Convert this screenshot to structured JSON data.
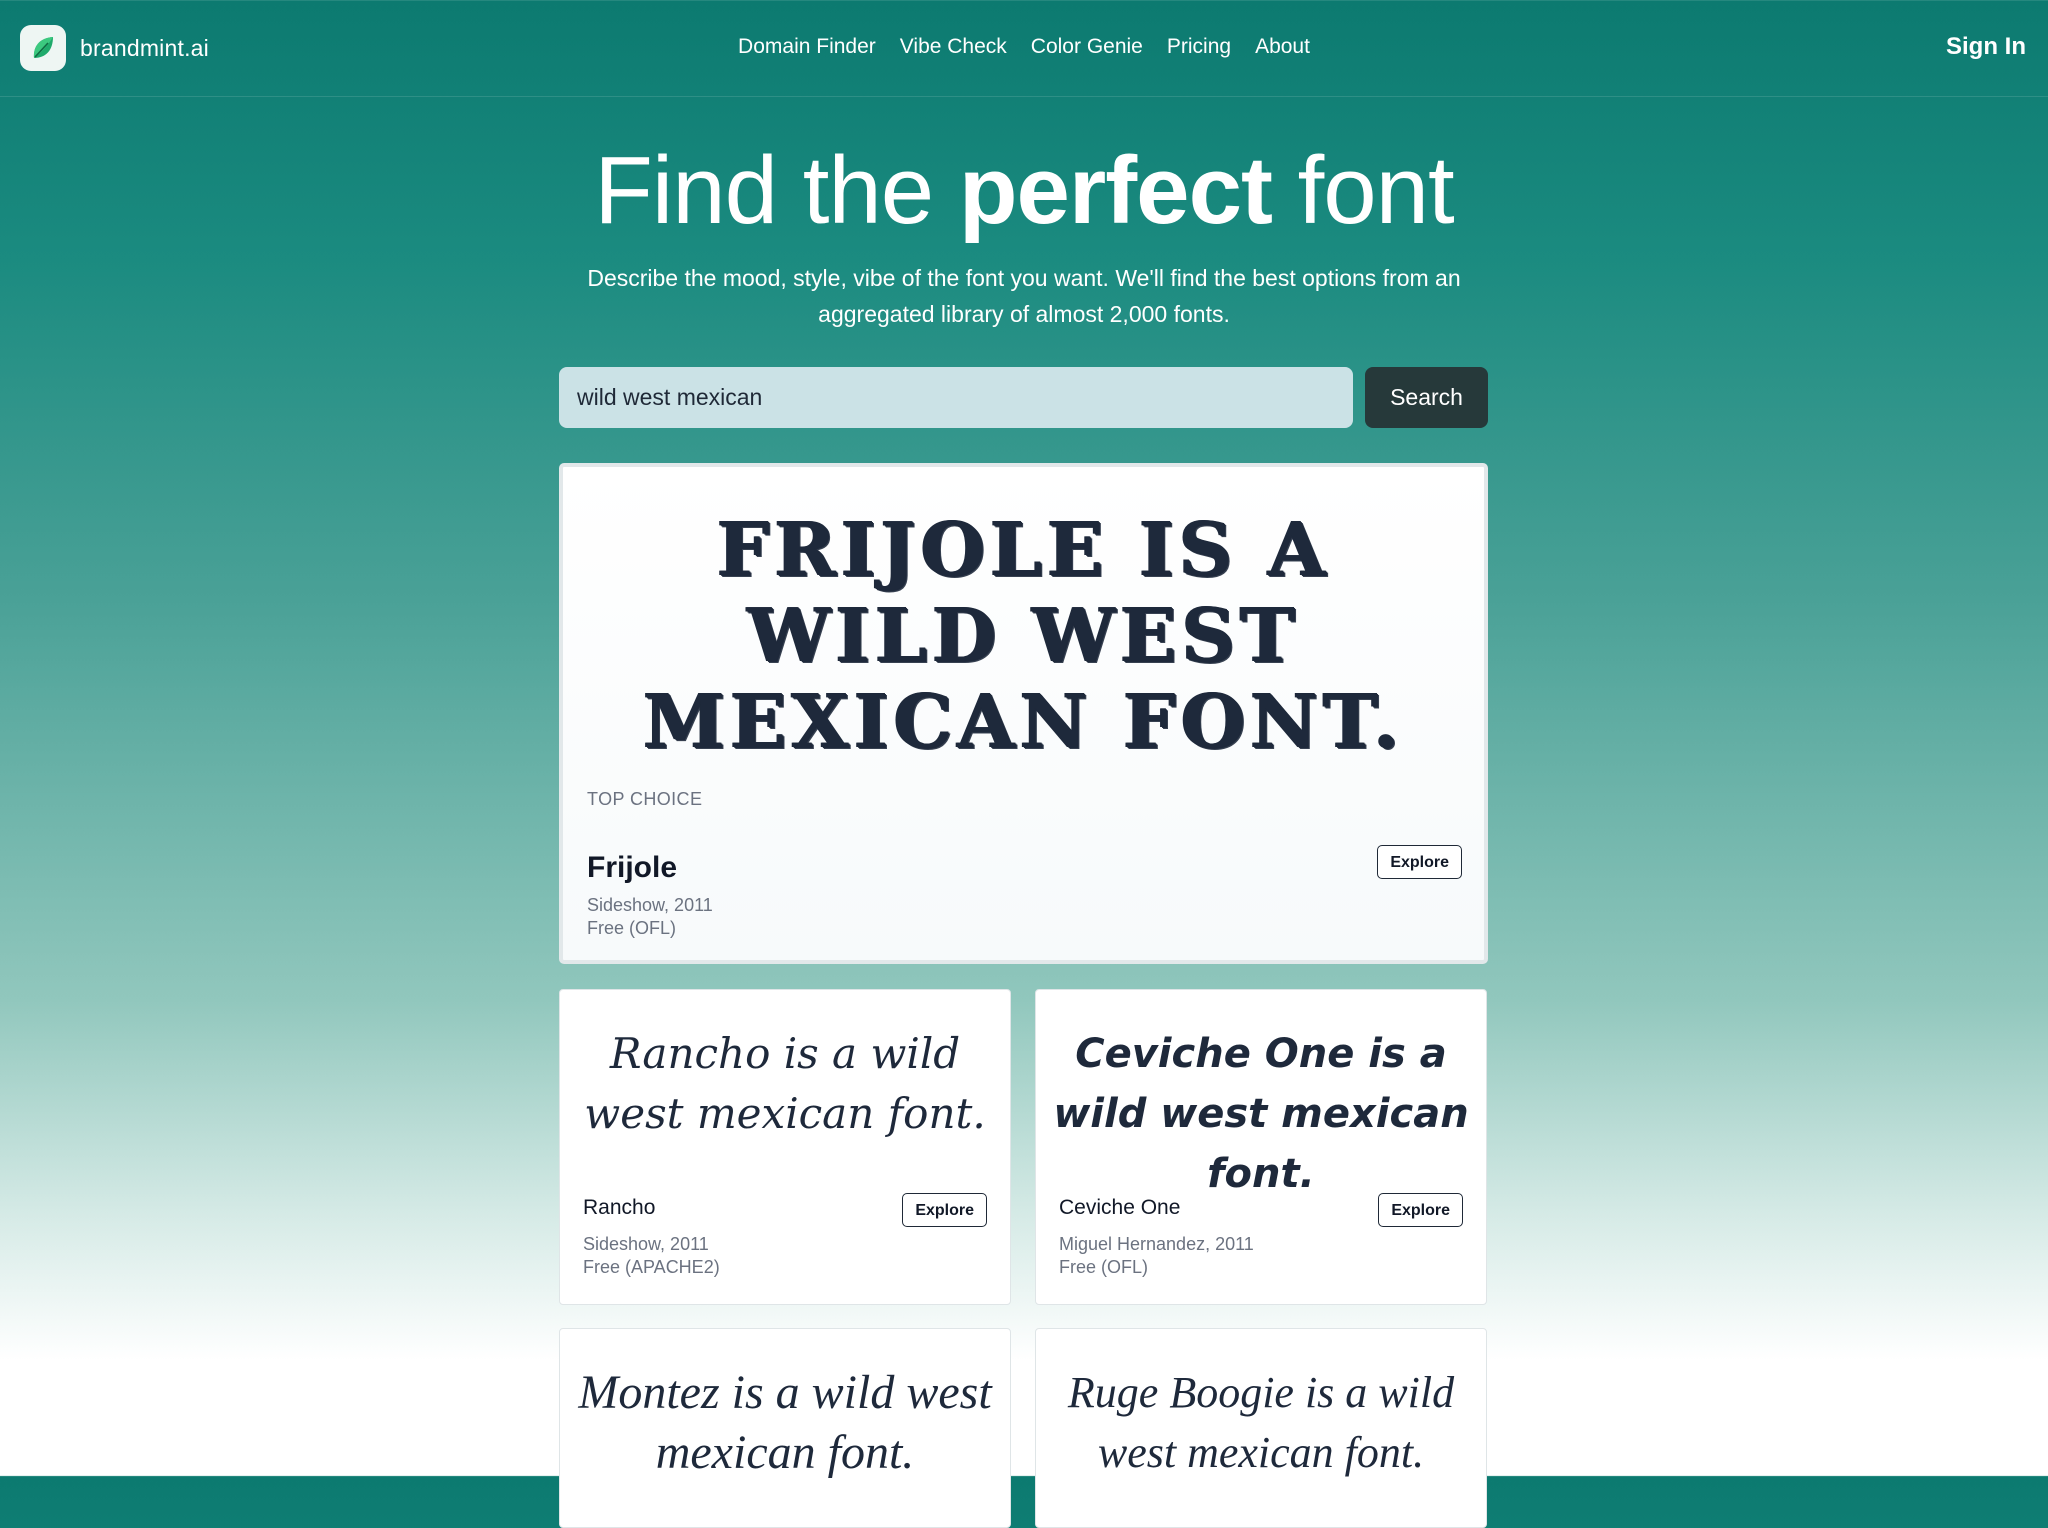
{
  "brand": {
    "name": "brandmint.ai",
    "logo_icon": "leaf-icon"
  },
  "nav": {
    "items": [
      {
        "label": "Domain Finder"
      },
      {
        "label": "Vibe Check"
      },
      {
        "label": "Color Genie"
      },
      {
        "label": "Pricing"
      },
      {
        "label": "About"
      }
    ],
    "sign_in": "Sign In"
  },
  "hero": {
    "title_pre": "Find the",
    "title_bold": "perfect",
    "title_post": "font",
    "subtitle": "Describe the mood, style, vibe of the font you want. We'll find the best options from an aggregated library of almost 2,000 fonts."
  },
  "search": {
    "value": "wild west mexican",
    "button": "Search"
  },
  "top_choice": {
    "sample": "Frijole is a wild west mexican font.",
    "eyebrow": "TOP CHOICE",
    "name": "Frijole",
    "meta1": "Sideshow, 2011",
    "meta2": "Free (OFL)",
    "explore": "Explore"
  },
  "results": [
    {
      "sample": "Rancho is a wild west mexican font.",
      "name": "Rancho",
      "meta1": "Sideshow, 2011",
      "meta2": "Free (APACHE2)",
      "explore": "Explore"
    },
    {
      "sample": "Ceviche One is a wild west mexican font.",
      "name": "Ceviche One",
      "meta1": "Miguel Hernandez, 2011",
      "meta2": "Free (OFL)",
      "explore": "Explore"
    },
    {
      "sample": "Montez is a wild west mexican font."
    },
    {
      "sample": "Ruge Boogie is a wild west mexican font."
    }
  ],
  "colors": {
    "header_teal": "#0c7a70",
    "search_field": "#cbe2e6",
    "search_button": "#26393a",
    "text_dark": "#1e293b"
  }
}
